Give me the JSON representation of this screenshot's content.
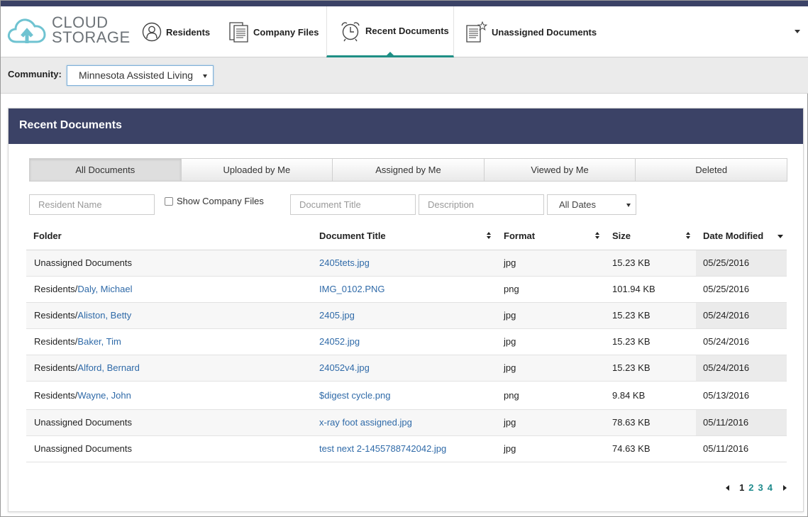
{
  "app": {
    "logo_line1": "CLOUD",
    "logo_line2": "STORAGE",
    "icon": "cloud-upload-icon"
  },
  "nav": {
    "tabs": [
      {
        "label": "Residents",
        "icon": "user-circle-icon"
      },
      {
        "label": "Company Files",
        "icon": "documents-icon"
      },
      {
        "label": "Recent Documents",
        "icon": "alarm-clock-icon",
        "active": true
      },
      {
        "label": "Unassigned Documents",
        "icon": "document-star-icon"
      }
    ]
  },
  "community": {
    "label": "Community:",
    "selected": "Minnesota Assisted Living"
  },
  "panel": {
    "title": "Recent Documents"
  },
  "filter_tabs": [
    {
      "label": "All Documents",
      "active": true
    },
    {
      "label": "Uploaded by Me"
    },
    {
      "label": "Assigned by Me"
    },
    {
      "label": "Viewed by Me"
    },
    {
      "label": "Deleted"
    }
  ],
  "filters": {
    "resident_placeholder": "Resident Name",
    "show_company_files": "Show Company Files",
    "title_placeholder": "Document Title",
    "description_placeholder": "Description",
    "dates_selected": "All Dates"
  },
  "table": {
    "columns": [
      "Folder",
      "Document Title",
      "Format",
      "Size",
      "Date Modified"
    ],
    "rows": [
      {
        "folder_prefix": "",
        "folder_name": "Unassigned Documents",
        "folder_link": false,
        "title": "2405tets.jpg",
        "format": "jpg",
        "size": "15.23 KB",
        "date": "05/25/2016"
      },
      {
        "folder_prefix": "Residents/",
        "folder_name": "Daly, Michael",
        "folder_link": true,
        "title": "IMG_0102.PNG",
        "format": "png",
        "size": "101.94 KB",
        "date": "05/25/2016"
      },
      {
        "folder_prefix": "Residents/",
        "folder_name": "Aliston, Betty",
        "folder_link": true,
        "title": "2405.jpg",
        "format": "jpg",
        "size": "15.23 KB",
        "date": "05/24/2016"
      },
      {
        "folder_prefix": "Residents/",
        "folder_name": "Baker, Tim",
        "folder_link": true,
        "title": "24052.jpg",
        "format": "jpg",
        "size": "15.23 KB",
        "date": "05/24/2016"
      },
      {
        "folder_prefix": "Residents/",
        "folder_name": "Alford, Bernard",
        "folder_link": true,
        "title": "24052v4.jpg",
        "format": "jpg",
        "size": "15.23 KB",
        "date": "05/24/2016"
      },
      {
        "folder_prefix": "Residents/",
        "folder_name": "Wayne, John",
        "folder_link": true,
        "title": "$digest cycle.png",
        "format": "png",
        "size": "9.84 KB",
        "date": "05/13/2016"
      },
      {
        "folder_prefix": "",
        "folder_name": "Unassigned Documents",
        "folder_link": false,
        "title": "x-ray foot assigned.jpg",
        "format": "jpg",
        "size": "78.63 KB",
        "date": "05/11/2016"
      },
      {
        "folder_prefix": "",
        "folder_name": "Unassigned Documents",
        "folder_link": false,
        "title": "test next 2-1455788742042.jpg",
        "format": "jpg",
        "size": "74.63 KB",
        "date": "05/11/2016"
      }
    ]
  },
  "pagination": {
    "pages": [
      "1",
      "2",
      "3",
      "4"
    ],
    "current": "1"
  },
  "colors": {
    "header_bg": "#3b4266",
    "accent": "#1f8f85",
    "link": "#2f6aa8"
  }
}
